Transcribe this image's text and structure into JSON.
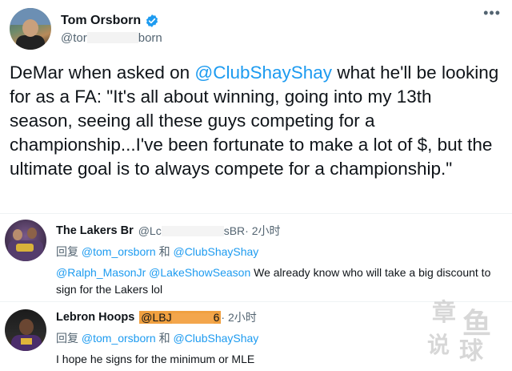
{
  "tweet": {
    "author_name": "Tom Orsborn",
    "handle_prefix": "@tor",
    "handle_suffix": "born",
    "menu_icon": "more-horizontal-icon",
    "verified_icon": "verified-badge-icon",
    "body_before": "DeMar when asked on ",
    "body_mention": "@ClubShayShay",
    "body_after": " what he'll be looking for as a FA: \"It's all about winning, going into my 13th season, seeing all these guys competing for a championship...I've been fortunate to make a lot of $, but the ultimate goal is to always compete for a championship.\""
  },
  "replies": [
    {
      "name": "The Lakers Br",
      "handle_prefix": "@Lc",
      "handle_suffix": "sBR",
      "time": " · 2小时",
      "replying_prefix": "回复 ",
      "replying_user1": "@tom_orsborn",
      "replying_conj": " 和 ",
      "replying_user2": "@ClubShayShay",
      "text_mention1": "@Ralph_MasonJr",
      "text_space": " ",
      "text_mention2": "@LakeShowSeason",
      "text_rest": " We already know who will take a big discount to sign for the Lakers lol"
    },
    {
      "name": "Lebron Hoops",
      "handle_prefix": "@LBJ",
      "handle_suffix": "6",
      "time": " · 2小时",
      "replying_prefix": "回复 ",
      "replying_user1": "@tom_orsborn",
      "replying_conj": " 和 ",
      "replying_user2": "@ClubShayShay",
      "text_rest": "I hope he signs for the minimum or MLE"
    }
  ],
  "watermark": {
    "c1": "章",
    "c2": "鱼",
    "c3": "说",
    "c4": "球"
  },
  "colors": {
    "link": "#1d9bf0",
    "secondary": "#536471",
    "highlight": "#f0a040"
  }
}
